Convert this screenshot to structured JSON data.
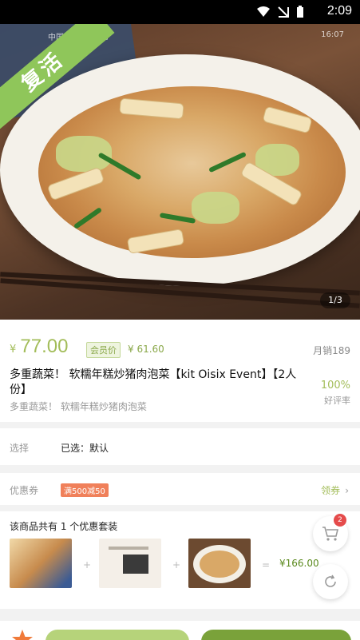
{
  "status_bar": {
    "time": "2:09"
  },
  "hero": {
    "ribbon_label": "复活",
    "pager": "1/3",
    "inner_status_left": "中国移动 HD 4G",
    "inner_status_right": "16:07"
  },
  "product": {
    "currency": "¥",
    "price": "77.00",
    "member_tag": "会员价",
    "member_price": "¥ 61.60",
    "sales": "月销189",
    "title": "多重蔬菜！ 软糯年糕炒猪肉泡菜【kit Oisix Event】【2人份】",
    "subtitle": "多重蔬菜！ 软糯年糕炒猪肉泡菜",
    "rating": "100%",
    "rating_label": "好评率"
  },
  "selection": {
    "label": "选择",
    "value": "已选：默认"
  },
  "coupon": {
    "label": "优惠券",
    "badge": "满500减50",
    "link": "领券"
  },
  "combo": {
    "title": "该商品共有 1 个优惠套装",
    "plus": "+",
    "equals": "=",
    "total": "¥166.00"
  },
  "cart": {
    "count": "2"
  },
  "colors": {
    "accent": "#a3bd5a",
    "ribbon": "#8fc65a",
    "badge": "#e54b4b",
    "coupon": "#f0805a"
  },
  "icons": [
    "wifi-icon",
    "sim-icon",
    "battery-icon",
    "chevron-right-icon",
    "cart-icon",
    "refresh-icon",
    "star-icon"
  ]
}
